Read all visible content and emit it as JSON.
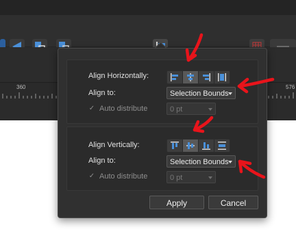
{
  "ruler": {
    "mark_360": "360",
    "mark_576": "576"
  },
  "align_horizontally": {
    "label": "Align Horizontally:",
    "align_to_label": "Align to:",
    "align_to_value": "Selection Bounds",
    "auto_distribute_label": "Auto distribute",
    "spacing_value": "0 pt",
    "buttons": [
      "align-left",
      "align-center",
      "align-right",
      "distribute-horizontal"
    ],
    "active_button": "align-center"
  },
  "align_vertically": {
    "label": "Align Vertically:",
    "align_to_label": "Align to:",
    "align_to_value": "Selection Bounds",
    "auto_distribute_label": "Auto distribute",
    "spacing_value": "0 pt",
    "buttons": [
      "align-top",
      "align-middle",
      "align-bottom",
      "distribute-vertical"
    ],
    "active_button": "align-middle"
  },
  "footer": {
    "apply_label": "Apply",
    "cancel_label": "Cancel"
  },
  "colors": {
    "annotation_arrow": "#e8141b",
    "toolbar_accent": "#4a90d9"
  }
}
